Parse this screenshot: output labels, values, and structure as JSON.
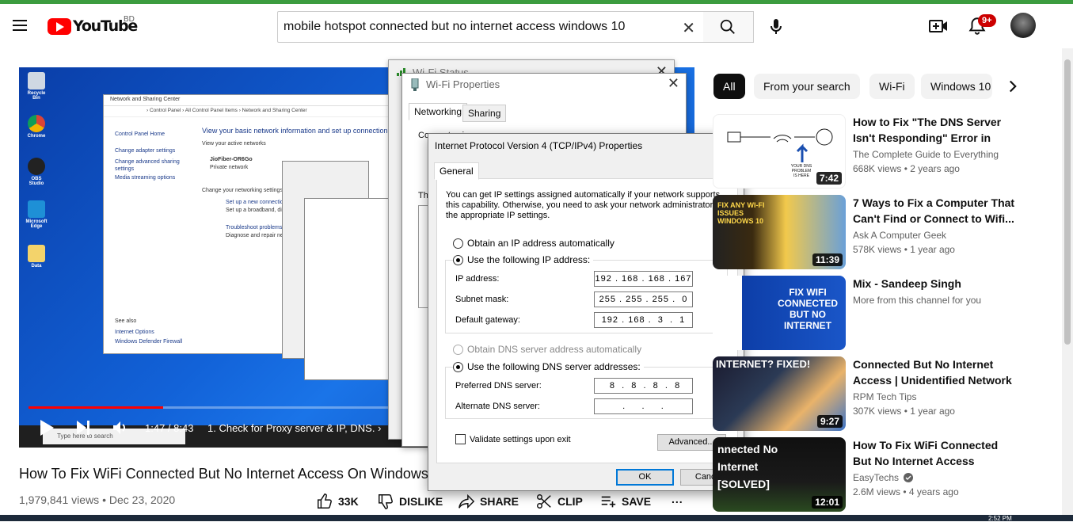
{
  "header": {
    "logo_text": "YouTube",
    "country_code": "BD",
    "search": {
      "value": "mobile hotspot connected but no internet access windows 10"
    },
    "notifications_badge": "9+"
  },
  "player": {
    "time": "1:47 / 8:43",
    "chapter": "1. Check for Proxy server & IP, DNS.",
    "chapter_arrow": "›",
    "progress_fraction": 0.205,
    "desktop": {
      "icons": [
        "Recycle Bin",
        "Chrome",
        "OBS Studio",
        "Microsoft Edge",
        "Data"
      ],
      "taskbar_search": "Type here to search",
      "control_panel": {
        "title": "Network and Sharing Center",
        "address": "› Control Panel › All Control Panel Items › Network and Sharing Center",
        "home": "Control Panel Home",
        "links": [
          "Change adapter settings",
          "Change advanced sharing settings",
          "Media streaming options"
        ],
        "heading": "View your basic network information and set up connections",
        "active_networks": "View your active networks",
        "network_name": "JioFiber-OR6Go",
        "network_type": "Private network",
        "change_settings": "Change your networking settings",
        "setup_link": "Set up a new connection",
        "setup_desc": "Set up a broadband, dial...",
        "troubleshoot_link": "Troubleshoot problems",
        "troubleshoot_desc": "Diagnose and repair net...",
        "see_also": "See also",
        "see_also_links": [
          "Internet Options",
          "Windows Defender Firewall"
        ]
      }
    }
  },
  "wifi_status": {
    "title": "Wi-Fi Status"
  },
  "wifi_properties": {
    "title": "Wi-Fi Properties",
    "tabs": [
      "Networking",
      "Sharing"
    ],
    "connect_using": "Connect using:",
    "this_connection": "Th"
  },
  "ipv4": {
    "title": "Internet Protocol Version 4 (TCP/IPv4) Properties",
    "tab": "General",
    "description": "You can get IP settings assigned automatically if your network supports this capability. Otherwise, you need to ask your network administrator for the appropriate IP settings.",
    "obtain_ip_auto": "Obtain an IP address automatically",
    "use_following_ip": "Use the following IP address:",
    "ip_label": "IP address:",
    "ip_value": "192 . 168 . 168 . 167",
    "subnet_label": "Subnet mask:",
    "subnet_value": "255 . 255 . 255 .  0",
    "gateway_label": "Default gateway:",
    "gateway_value": "192 . 168 .  3  .  1",
    "obtain_dns_auto": "Obtain DNS server address automatically",
    "use_following_dns": "Use the following DNS server addresses:",
    "preferred_dns_label": "Preferred DNS server:",
    "preferred_dns_value": " 8  .  8  .  8  .  8",
    "alternate_dns_label": "Alternate DNS server:",
    "alternate_dns_value": "   .     .     .   ",
    "validate": "Validate settings upon exit",
    "advanced": "Advanced...",
    "ok": "OK",
    "cancel": "Cancel"
  },
  "video": {
    "title": "How To Fix WiFi Connected But No Internet Access On Windows",
    "views": "1,979,841 views",
    "date": "Dec 23, 2020",
    "meta_sep": "•",
    "likes": "33K",
    "dislike": "DISLIKE",
    "share": "SHARE",
    "clip": "CLIP",
    "save": "SAVE",
    "more": "..."
  },
  "chips": [
    "All",
    "From your search",
    "Wi-Fi",
    "Windows 10"
  ],
  "recommendations": [
    {
      "title": "How to Fix \"The DNS Server Isn't Responding\" Error in Windows...",
      "channel": "The Complete Guide to Everything",
      "views": "668K views",
      "age": "2 years ago",
      "duration": "7:42",
      "thumb_text": "YOUR DNS PROBLEM IS HERE"
    },
    {
      "title": "7 Ways to Fix a Computer That Can't Find or Connect to Wifi...",
      "channel": "Ask A Computer Geek",
      "views": "578K views",
      "age": "1 year ago",
      "duration": "11:39",
      "thumb_text": "FIX ANY WI-FI ISSUES WINDOWS 10"
    },
    {
      "title": "Mix - Sandeep Singh",
      "channel": "More from this channel for you",
      "views": "",
      "age": "",
      "duration": "",
      "thumb_text": "FIX WIFI CONNECTED BUT NO INTERNET"
    },
    {
      "title": "Connected But No Internet Access | Unidentified Network ...",
      "channel": "RPM Tech Tips",
      "views": "307K views",
      "age": "1 year ago",
      "duration": "9:27",
      "thumb_text": "INTERNET? FIXED!"
    },
    {
      "title": "How To Fix WiFi Connected But No Internet Access (Windows...",
      "channel": "EasyTechs",
      "views": "2.6M views",
      "age": "4 years ago",
      "duration": "12:01",
      "thumb_text": "nnected No Internet [SOLVED]"
    }
  ],
  "stats_sep": "•",
  "taskbar_clock": "2:52 PM",
  "colors": {
    "brand_red": "#ff0000",
    "chip_active": "#0f0f0f",
    "win_focus": "#0078d7"
  }
}
